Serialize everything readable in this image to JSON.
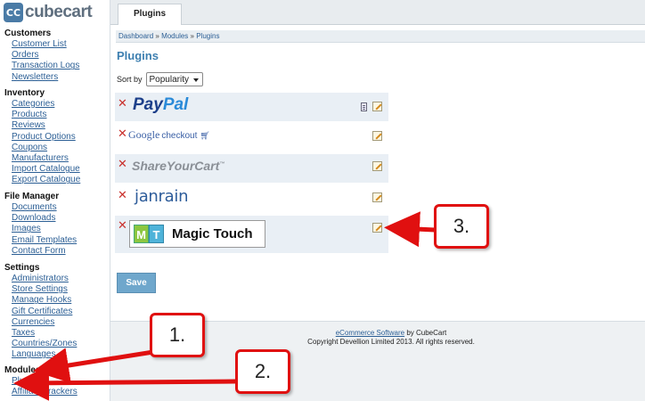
{
  "app": {
    "logo_mark": "CC",
    "logo_text": "cubecart"
  },
  "sidebar": {
    "sections": [
      {
        "title": "Customers",
        "items": [
          "Customer List",
          "Orders",
          "Transaction Logs",
          "Newsletters"
        ]
      },
      {
        "title": "Inventory",
        "items": [
          "Categories",
          "Products",
          "Reviews",
          "Product Options",
          "Coupons",
          "Manufacturers",
          "Import Catalogue",
          "Export Catalogue"
        ]
      },
      {
        "title": "File Manager",
        "items": [
          "Documents",
          "Downloads",
          "Images",
          "Email Templates",
          "Contact Form"
        ]
      },
      {
        "title": "Settings",
        "items": [
          "Administrators",
          "Store Settings",
          "Manage Hooks",
          "Gift Certificates",
          "Currencies",
          "Taxes",
          "Countries/Zones",
          "Languages"
        ]
      },
      {
        "title": "Modules",
        "items": [
          "Plugins",
          "Affiliate Trackers"
        ]
      }
    ]
  },
  "tabs": {
    "active": "Plugins"
  },
  "breadcrumb": {
    "items": [
      "Dashboard",
      "Modules",
      "Plugins"
    ],
    "separator": "»"
  },
  "page": {
    "title": "Plugins",
    "sort_label": "Sort by",
    "sort_value": "Popularity"
  },
  "plugins": [
    {
      "name": "PayPal",
      "logo_a": "Pay",
      "logo_b": "Pal",
      "has_doc": true
    },
    {
      "name": "Google checkout",
      "logo_a": "Google",
      "logo_b": "checkout",
      "has_doc": false
    },
    {
      "name": "ShareYourCart",
      "logo_a": "ShareYourCart",
      "logo_b": "™",
      "has_doc": false
    },
    {
      "name": "janrain",
      "logo_a": "janrain",
      "has_doc": false
    },
    {
      "name": "Magic Touch",
      "badge_m": "M",
      "badge_t": "T",
      "logo_a": "Magic Touch",
      "has_doc": false
    }
  ],
  "buttons": {
    "save": "Save"
  },
  "footer": {
    "link_text": "eCommerce Software",
    "by_text": "by CubeCart",
    "copyright": "Copyright Devellion Limited 2013. All rights reserved."
  },
  "annotations": [
    "1.",
    "2.",
    "3."
  ],
  "colors": {
    "accent": "#3d7fb0",
    "link": "#2c5f95",
    "callout_border": "#e01010",
    "save_button": "#6fa7cc"
  }
}
